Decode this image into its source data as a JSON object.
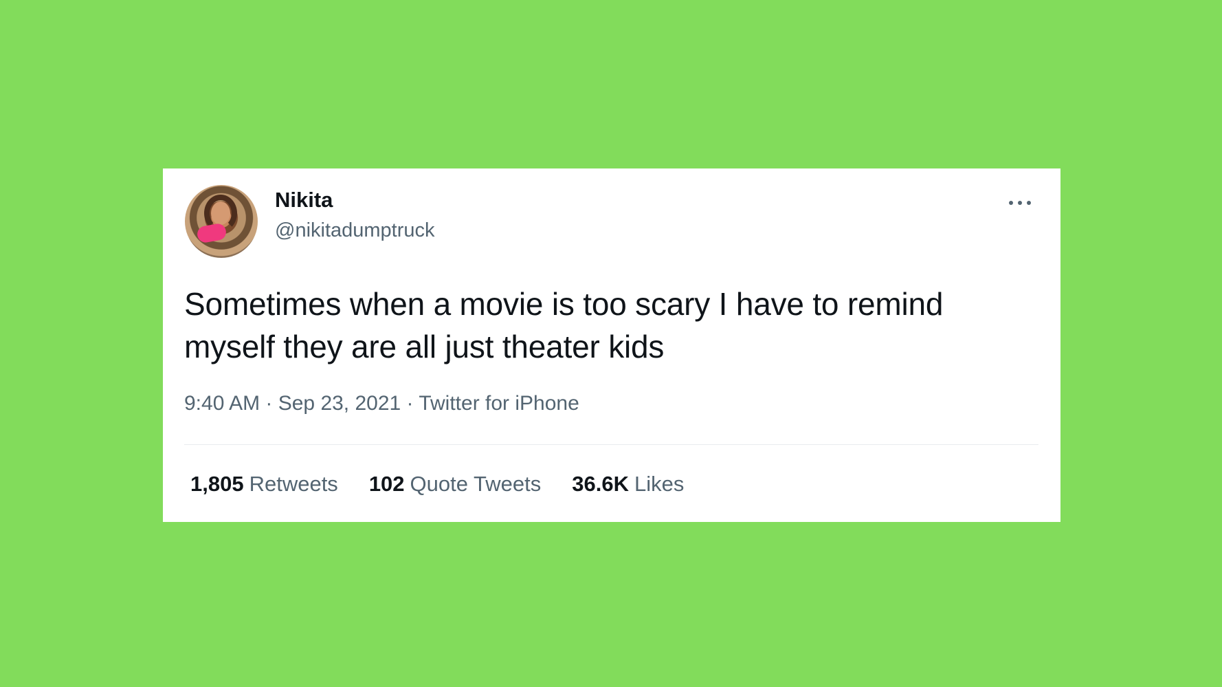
{
  "colors": {
    "background": "#82dc5b",
    "card": "#ffffff",
    "text_primary": "#0f1419",
    "text_secondary": "#536471"
  },
  "tweet": {
    "author": {
      "name": "Nikita",
      "handle": "@nikitadumptruck",
      "avatar_icon": "profile-photo"
    },
    "menu_icon": "more-options-icon",
    "text_line_1": "Sometimes when a movie is too scary I have to remind",
    "text_line_2": "myself they are all just theater kids",
    "meta": "9:40 AM · Sep 23, 2021 · Twitter for iPhone",
    "stats": {
      "retweets": {
        "count": "1,805",
        "label": "Retweets"
      },
      "quote_tweets": {
        "count": "102",
        "label": "Quote Tweets"
      },
      "likes": {
        "count": "36.6K",
        "label": "Likes"
      }
    }
  }
}
